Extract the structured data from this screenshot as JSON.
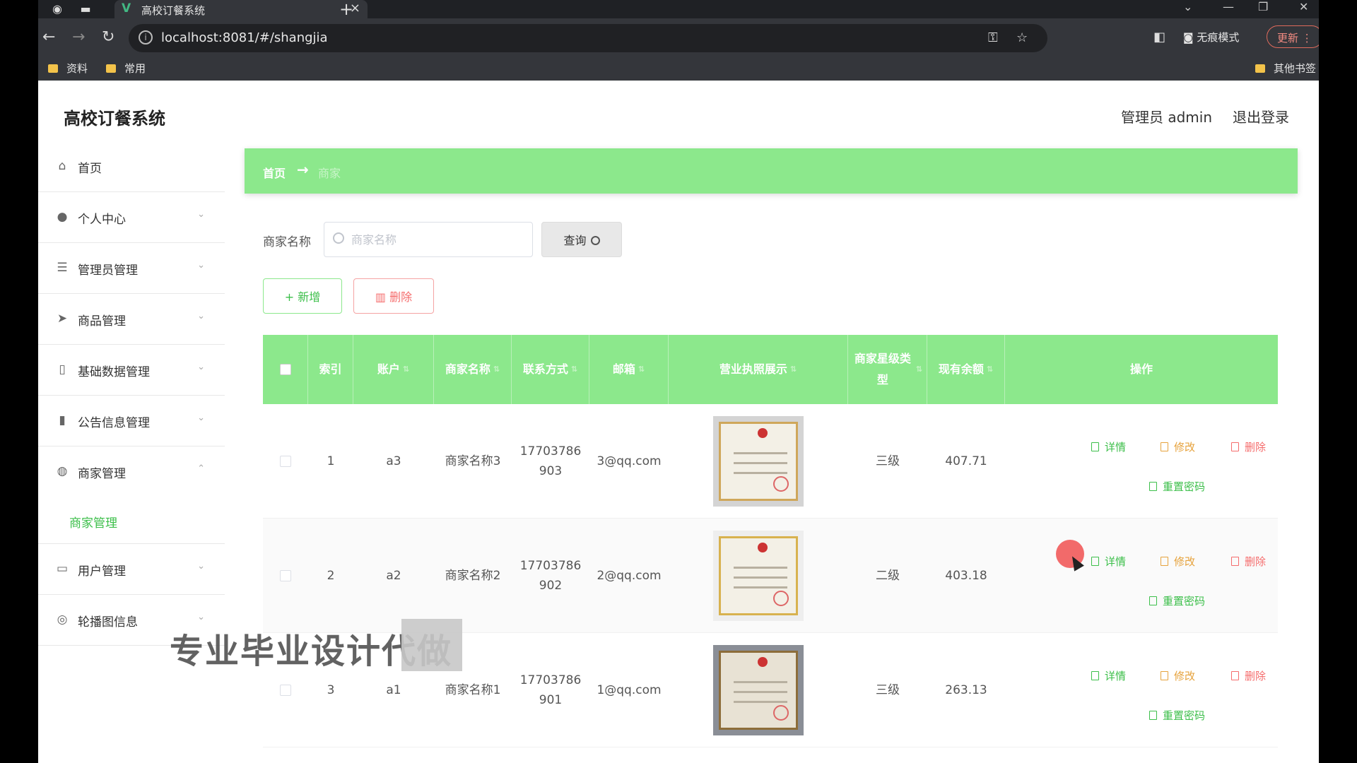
{
  "browser": {
    "tab_title": "高校订餐系统",
    "url": "localhost:8081/#/shangjia",
    "incognito_label": "无痕模式",
    "update_label": "更新",
    "bookmarks": [
      "资料",
      "常用"
    ],
    "other_bookmarks": "其他书签"
  },
  "header": {
    "title": "高校订餐系统",
    "user": "管理员 admin",
    "logout": "退出登录"
  },
  "sidebar": {
    "items": [
      {
        "label": "首页",
        "icon": "home-icon"
      },
      {
        "label": "个人中心",
        "icon": "user-icon"
      },
      {
        "label": "管理员管理",
        "icon": "list-icon"
      },
      {
        "label": "商品管理",
        "icon": "send-icon"
      },
      {
        "label": "基础数据管理",
        "icon": "phone-icon"
      },
      {
        "label": "公告信息管理",
        "icon": "chart-icon"
      },
      {
        "label": "商家管理",
        "icon": "location-icon"
      },
      {
        "label": "用户管理",
        "icon": "id-card-icon"
      },
      {
        "label": "轮播图信息",
        "icon": "settings-icon"
      }
    ],
    "sub_active": "商家管理"
  },
  "breadcrumb": {
    "home": "首页",
    "arrow": "→",
    "current": "商家"
  },
  "search": {
    "label": "商家名称",
    "placeholder": "商家名称",
    "button": "查询"
  },
  "actions": {
    "add": "+ 新增",
    "delete": "删除"
  },
  "table": {
    "headers": [
      "索引",
      "账户",
      "商家名称",
      "联系方式",
      "邮箱",
      "营业执照展示",
      "商家星级类型",
      "现有余额",
      "操作"
    ],
    "rows": [
      {
        "index": "1",
        "account": "a3",
        "name": "商家名称3",
        "phone": "17703786903",
        "email": "3@qq.com",
        "level": "三级",
        "balance": "407.71"
      },
      {
        "index": "2",
        "account": "a2",
        "name": "商家名称2",
        "phone": "17703786902",
        "email": "2@qq.com",
        "level": "二级",
        "balance": "403.18"
      },
      {
        "index": "3",
        "account": "a1",
        "name": "商家名称1",
        "phone": "17703786901",
        "email": "1@qq.com",
        "level": "三级",
        "balance": "263.13"
      }
    ],
    "ops": {
      "detail": "详情",
      "edit": "修改",
      "delete": "删除",
      "reset": "重置密码"
    }
  },
  "watermark": "专业毕业设计代做",
  "colors": {
    "accent": "#8ce88c",
    "success": "#3cbf4a",
    "warning": "#e6a23c",
    "danger": "#f56c6c"
  }
}
